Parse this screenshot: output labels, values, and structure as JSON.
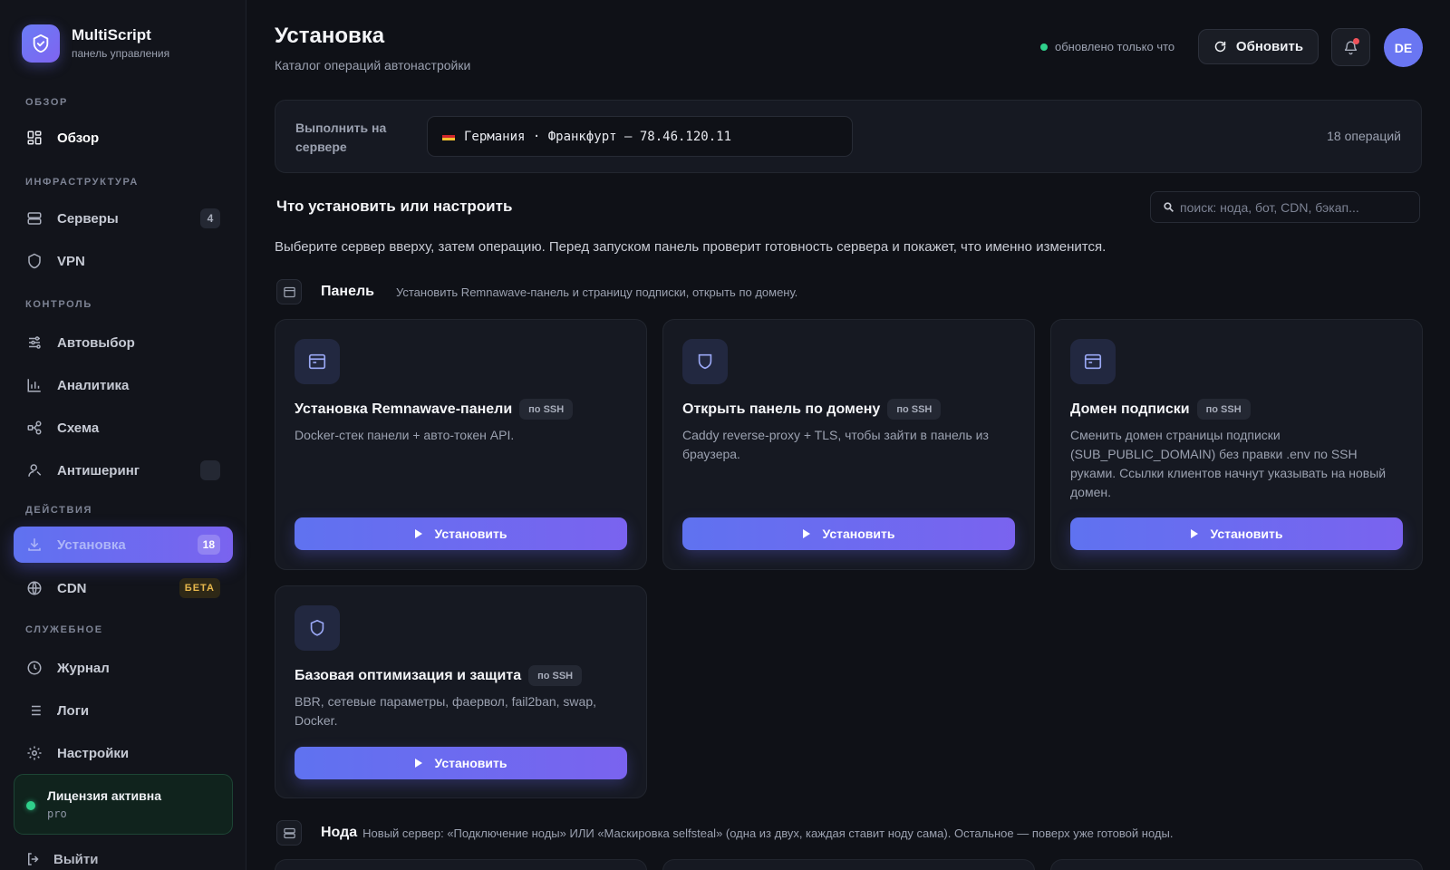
{
  "brand": {
    "title": "MultiScript",
    "subtitle": "панель управления"
  },
  "sidebar": {
    "sections": {
      "overview": "ОБЗОР",
      "infra": "ИНФРАСТРУКТУРА",
      "control": "КОНТРОЛЬ",
      "actions": "ДЕЙСТВИЯ",
      "service": "СЛУЖЕБНОЕ"
    },
    "items": {
      "overview": {
        "label": "Обзор",
        "icon": "grid-icon"
      },
      "servers": {
        "label": "Серверы",
        "icon": "server-icon",
        "badge": "4"
      },
      "vpn": {
        "label": "VPN",
        "icon": "shield-icon"
      },
      "autoselect": {
        "label": "Автовыбор",
        "icon": "sliders-icon"
      },
      "analytics": {
        "label": "Аналитика",
        "icon": "bar-chart-icon"
      },
      "scheme": {
        "label": "Схема",
        "icon": "nodes-icon"
      },
      "antisharing": {
        "label": "Антишеринг",
        "icon": "user-icon",
        "badge": ""
      },
      "install": {
        "label": "Установка",
        "icon": "download-icon",
        "badge": "18"
      },
      "cdn": {
        "label": "CDN",
        "icon": "globe-icon",
        "badge": "БЕТА"
      },
      "journal": {
        "label": "Журнал",
        "icon": "clock-icon"
      },
      "logs": {
        "label": "Логи",
        "icon": "list-icon"
      },
      "settings": {
        "label": "Настройки",
        "icon": "gear-icon"
      }
    },
    "license": {
      "title": "Лицензия активна",
      "plan": "pro"
    },
    "logout": "Выйти"
  },
  "header": {
    "title": "Установка",
    "subtitle": "Каталог операций автонастройки",
    "status": "обновлено только что",
    "refresh_label": "Обновить",
    "avatar": "DE"
  },
  "server_bar": {
    "label": "Выполнить на сервере",
    "selected": "Германия · Франкфурт — 78.46.120.11",
    "count": "18 операций"
  },
  "catalog": {
    "title": "Что установить или настроить",
    "search_placeholder": "поиск: нода, бот, CDN, бэкап...",
    "hint": "Выберите сервер вверху, затем операцию. Перед запуском панель проверит готовность сервера и покажет, что именно изменится."
  },
  "groups": [
    {
      "name": "Панель",
      "description": "Установить Remnawave-панель и страницу подписки, открыть по домену.",
      "cards": [
        {
          "title": "Установка Remnawave-панели",
          "tag": "по SSH",
          "description": "Docker-стек панели + авто-токен API.",
          "button": "Установить",
          "icon": "window-icon"
        },
        {
          "title": "Открыть панель по домену",
          "tag": "по SSH",
          "description": "Caddy reverse-proxy + TLS, чтобы зайти в панель из браузера.",
          "button": "Установить",
          "icon": "shield-icon"
        },
        {
          "title": "Домен подписки",
          "tag": "по SSH",
          "description": "Сменить домен страницы подписки (SUB_PUBLIC_DOMAIN) без правки .env по SSH руками. Ссылки клиентов начнут указывать на новый домен.",
          "button": "Установить",
          "icon": "window-icon"
        },
        {
          "title": "Базовая оптимизация и защита",
          "tag": "по SSH",
          "description": "BBR, сетевые параметры, фаервол, fail2ban, swap, Docker.",
          "button": "Установить",
          "icon": "shield-icon"
        }
      ]
    },
    {
      "name": "Нода",
      "description": "Новый сервер: «Подключение ноды» ИЛИ «Маскировка selfsteal» (одна из двух, каждая ставит ноду сама). Остальное — поверх уже готовой ноды."
    }
  ],
  "colors": {
    "accent_start": "#5f72f0",
    "accent_end": "#7a63ef",
    "success": "#2fd08b",
    "beta": "#e8b84c",
    "background": "#0f1117"
  }
}
